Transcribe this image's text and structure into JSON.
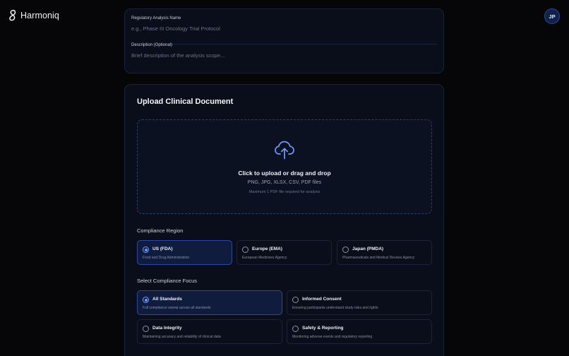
{
  "brand": {
    "name": "Harmoniq"
  },
  "user": {
    "initials": "JP"
  },
  "analysis": {
    "name_label": "Regulatory Analysis Name",
    "name_placeholder": "e.g., Phase III Oncology Trial Protocol",
    "description_label": "Description (Optional)",
    "description_placeholder": "Brief description of the analysis scope..."
  },
  "upload": {
    "title": "Upload Clinical Document",
    "dropzone_title": "Click to upload or drag and drop",
    "file_types": "PNG, JPG, XLSX, CSV, PDF files",
    "note": "Maximum 1 PDF file required for analysis"
  },
  "region": {
    "label": "Compliance Region",
    "options": [
      {
        "title": "US (FDA)",
        "subtitle": "Food and Drug Administration",
        "selected": true
      },
      {
        "title": "Europe (EMA)",
        "subtitle": "European Medicines Agency",
        "selected": false
      },
      {
        "title": "Japan (PMDA)",
        "subtitle": "Pharmaceuticals and Medical Devices Agency",
        "selected": false
      }
    ]
  },
  "focus": {
    "label": "Select Compliance Focus",
    "options": [
      {
        "title": "All Standards",
        "subtitle": "Full compliance sweep across all standards",
        "selected": true
      },
      {
        "title": "Informed Consent",
        "subtitle": "Ensuring participants understand study risks and rights",
        "selected": false
      },
      {
        "title": "Data Integrity",
        "subtitle": "Maintaining accuracy and reliability of clinical data",
        "selected": false
      },
      {
        "title": "Safety & Reporting",
        "subtitle": "Monitoring adverse events and regulatory reporting",
        "selected": false
      }
    ]
  },
  "colors": {
    "accent": "#6f9bff",
    "background": "#060608",
    "card": "#0a0e1a",
    "selected": "#101c3e"
  },
  "icons": {
    "brand": "harmoniq-logo-icon",
    "upload": "cloud-upload-icon"
  }
}
